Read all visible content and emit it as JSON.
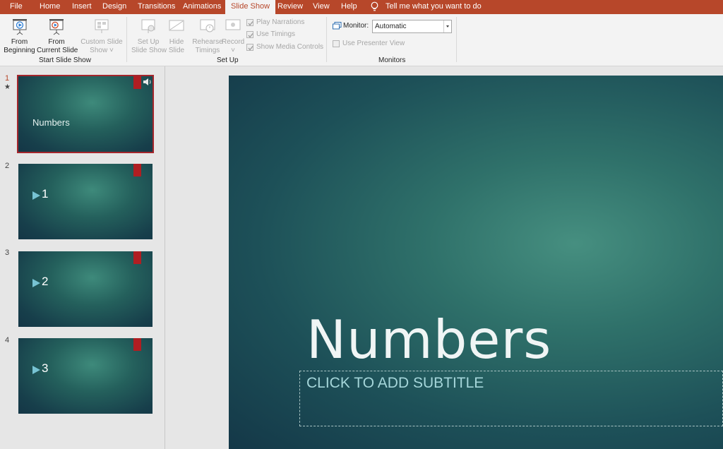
{
  "tabs": [
    {
      "label": "File"
    },
    {
      "label": "Home"
    },
    {
      "label": "Insert"
    },
    {
      "label": "Design"
    },
    {
      "label": "Transitions"
    },
    {
      "label": "Animations"
    },
    {
      "label": "Slide Show",
      "active": true
    },
    {
      "label": "Review"
    },
    {
      "label": "View"
    },
    {
      "label": "Help"
    }
  ],
  "tell_me": "Tell me what you want to do",
  "ribbon": {
    "start_group": {
      "label": "Start Slide Show",
      "from_beginning": [
        "From",
        "Beginning"
      ],
      "from_current": [
        "From",
        "Current Slide"
      ],
      "custom": [
        "Custom Slide",
        "Show ˅"
      ]
    },
    "setup_group": {
      "label": "Set Up",
      "setup_show": [
        "Set Up",
        "Slide Show"
      ],
      "hide_slide": [
        "Hide",
        "Slide"
      ],
      "rehearse": [
        "Rehearse",
        "Timings"
      ],
      "record": [
        "Record",
        "˅"
      ],
      "play_narrations": "Play Narrations",
      "use_timings": "Use Timings",
      "show_media_controls": "Show Media Controls"
    },
    "monitors_group": {
      "label": "Monitors",
      "monitor_label": "Monitor:",
      "monitor_value": "Automatic",
      "use_presenter_view": "Use Presenter View"
    }
  },
  "slides": [
    {
      "number": "1",
      "text": "Numbers",
      "active": true,
      "has_audio": true,
      "has_animation_star": true
    },
    {
      "number": "2",
      "text": "1"
    },
    {
      "number": "3",
      "text": "2"
    },
    {
      "number": "4",
      "text": "3"
    }
  ],
  "main_slide": {
    "title": "Numbers",
    "subtitle_placeholder": "CLICK TO ADD SUBTITLE"
  },
  "colors": {
    "accent": "#b7472a",
    "selection": "#a4262c",
    "tag": "#b01e22"
  }
}
